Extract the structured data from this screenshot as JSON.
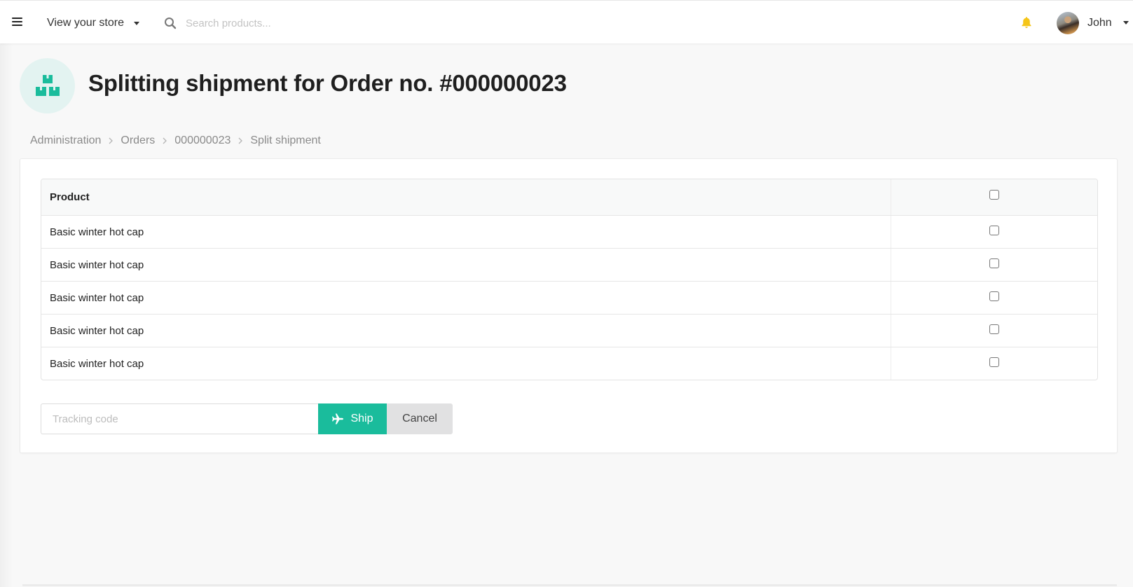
{
  "topbar": {
    "menu_icon": "hamburger-icon",
    "store_menu_label": "View your store",
    "search_placeholder": "Search products...",
    "search_value": "",
    "notification_icon": "bell-icon",
    "notification_color": "#f5c518",
    "user_name": "John"
  },
  "page": {
    "icon": "boxes-icon",
    "icon_color": "#1abc9c",
    "title": "Splitting shipment for Order no. #000000023"
  },
  "breadcrumb": [
    {
      "label": "Administration"
    },
    {
      "label": "Orders"
    },
    {
      "label": "000000023"
    },
    {
      "label": "Split shipment"
    }
  ],
  "table": {
    "columns": [
      "Product",
      ""
    ],
    "select_all_checked": false,
    "rows": [
      {
        "product": "Basic winter hot cap",
        "checked": false
      },
      {
        "product": "Basic winter hot cap",
        "checked": false
      },
      {
        "product": "Basic winter hot cap",
        "checked": false
      },
      {
        "product": "Basic winter hot cap",
        "checked": false
      },
      {
        "product": "Basic winter hot cap",
        "checked": false
      }
    ]
  },
  "form": {
    "tracking_placeholder": "Tracking code",
    "tracking_value": "",
    "ship_label": "Ship",
    "ship_icon": "plane-icon",
    "cancel_label": "Cancel",
    "accent_color": "#1abc9c"
  }
}
